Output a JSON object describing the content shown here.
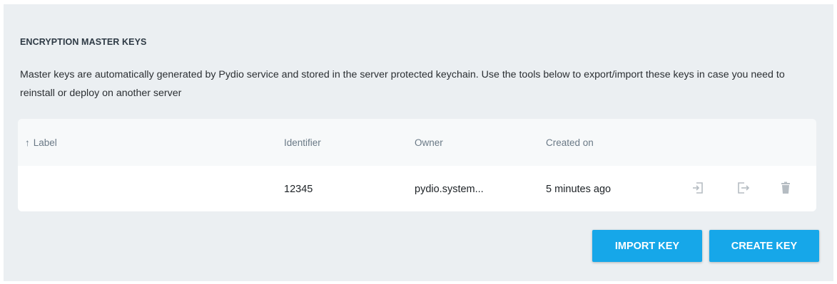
{
  "section": {
    "title": "ENCRYPTION MASTER KEYS",
    "description": "Master keys are automatically generated by Pydio service and stored in the server protected keychain. Use the tools below to export/import these keys in case you need to reinstall or deploy on another server"
  },
  "table": {
    "columns": {
      "label": "Label",
      "identifier": "Identifier",
      "owner": "Owner",
      "created": "Created on"
    },
    "sort_icon": "arrow-up-icon",
    "rows": [
      {
        "label": "",
        "identifier": "12345",
        "owner": "pydio.system...",
        "created": "5 minutes ago",
        "actions": [
          "import-key-icon",
          "export-key-icon",
          "delete-icon"
        ]
      }
    ]
  },
  "buttons": {
    "import": "IMPORT KEY",
    "create": "CREATE KEY"
  },
  "colors": {
    "background": "#ebeff2",
    "accent": "#16a7e9",
    "icon": "#b5bcc2"
  }
}
